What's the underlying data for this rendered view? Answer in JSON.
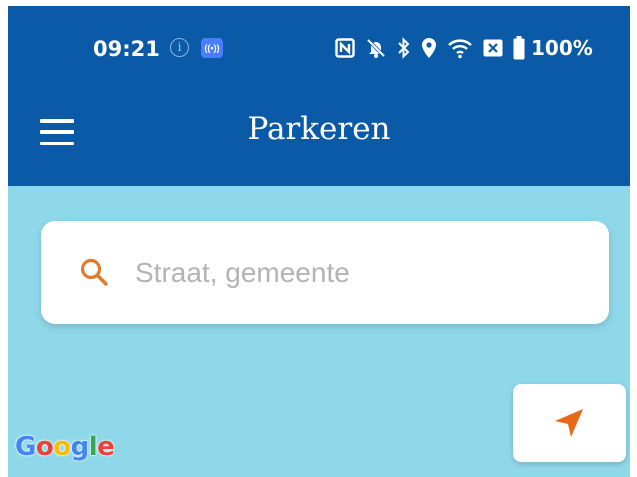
{
  "status_bar": {
    "time": "09:21",
    "battery": "100%",
    "icons": [
      "info-icon",
      "live-broadcast-icon",
      "nfc-icon",
      "do-not-disturb-bell-icon",
      "bluetooth-icon",
      "location-pin-icon",
      "wifi-icon",
      "close-box-icon",
      "battery-icon"
    ]
  },
  "app_bar": {
    "title": "Parkeren",
    "menu_icon": "hamburger-menu-icon",
    "background_color": "#0b5aa8"
  },
  "search": {
    "placeholder": "Straat, gemeente",
    "value": "",
    "icon": "search-icon",
    "icon_color": "#e07a2e"
  },
  "map": {
    "background_color": "#8fd8ea",
    "attribution": "Google",
    "locate_icon": "navigation-arrow-icon",
    "locate_icon_color": "#e8691c"
  }
}
